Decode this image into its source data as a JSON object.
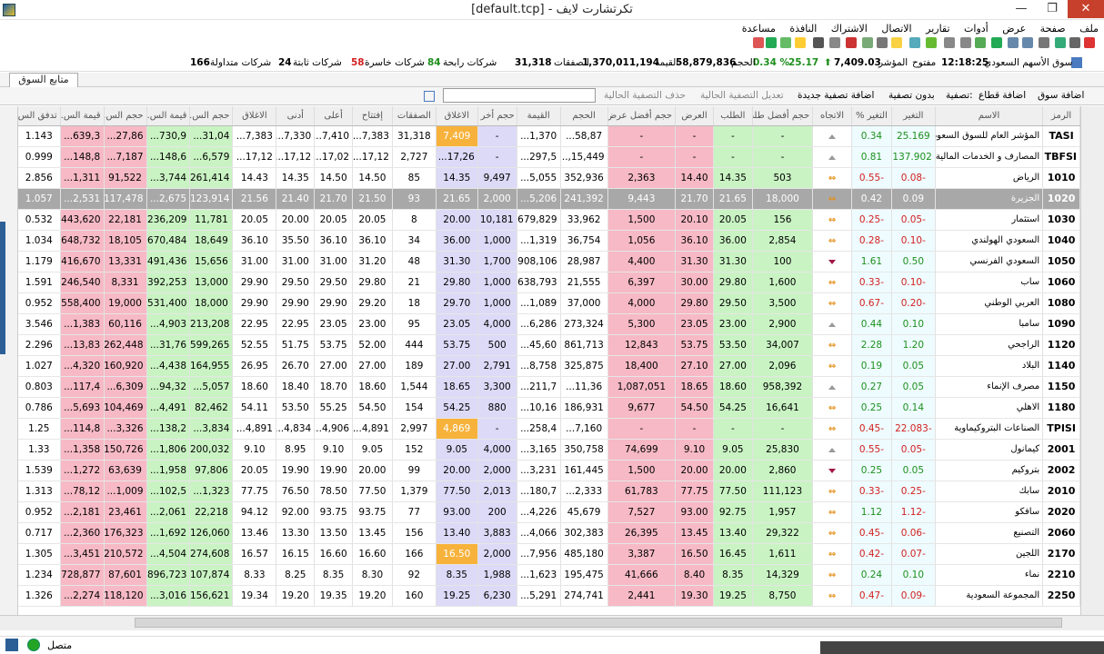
{
  "window": {
    "title": "[default.tcp] - تكرتشارت لايف",
    "min": "—",
    "max": "❐",
    "close": "✕"
  },
  "menu": [
    "ملف",
    "صفحة",
    "عرض",
    "أدوات",
    "تقارير",
    "الاتصال",
    "الاشتراك",
    "النافذة",
    "مساعدة"
  ],
  "marketstrip": {
    "market": "سوق الأسهم السعودي",
    "time": "12:18:25",
    "state": "مفتوح",
    "index_label": "المؤشر",
    "index": "7,409.03",
    "change": "25.17",
    "pct": "0.34 %",
    "vol_label": "الحجم",
    "volume": "58,879,836",
    "val_label": "القيمة",
    "value": "1,370,011,194",
    "trades_label": "الصفقات",
    "trades": "31,318",
    "up_label": "شركات رابحة",
    "up": "84",
    "down_label": "شركات خاسرة",
    "down": "58",
    "flat_label": "شركات ثابتة",
    "flat": "24",
    "traded_label": "شركات متداولة",
    "traded": "166"
  },
  "tab": {
    "label": "متابع السوق"
  },
  "filterbar": {
    "add_symbol": "اضافة سوق",
    "add_sector": "اضافة قطاع",
    "filter": "تصفية:",
    "no_filter": "بدون تصفية",
    "new_filter": "اضافة تصفية جديدة",
    "edit_filter": "تعديل التصفية الحالية",
    "delete_filter": "حذف التصفية الحالية"
  },
  "columns": [
    "الرمز",
    "الاسم",
    "التغير",
    "التغير %",
    "الاتجاه",
    "حجم أفضل طلب",
    "الطلب",
    "العرض",
    "حجم أفضل عرض",
    "الحجم",
    "القيمة",
    "حجم أخر",
    "الاغلاق",
    "الصفقات",
    "إفتتاح",
    "أعلى",
    "أدنى",
    "الاغلاق",
    "حجم الس...",
    "قيمة الس...",
    "حجم الس...",
    "قيمة الس...",
    "تدفق الس..."
  ],
  "rows": [
    {
      "sym": "TASI",
      "name": "المؤشر العام للسوق السعودي",
      "chg": "25.169",
      "pct": "0.34",
      "dir": "up",
      "bq": "-",
      "bid": "-",
      "ask": "-",
      "aq": "-",
      "vol": "58,87...",
      "val": "1,370...",
      "lastq": "-",
      "close": "7,409",
      "trades": "31,318",
      "open": "7,383...",
      "high": "7,410...",
      "low": "7,330...",
      "prev": "7,383...",
      "c1": "31,04...",
      "c2": "730,9...",
      "c3": "27,86...",
      "c4": "639,3...",
      "c5": "1.143"
    },
    {
      "sym": "TBFSI",
      "name": "المصارف و الخدمات المالية",
      "chg": "137.902",
      "pct": "0.81",
      "dir": "up",
      "bq": "-",
      "bid": "-",
      "ask": "-",
      "aq": "-",
      "vol": "15,449,...",
      "val": "297,5...",
      "lastq": "-",
      "close": "17,26...",
      "trades": "2,727",
      "open": "17,12...",
      "high": "17,02...",
      "low": "17,12...",
      "prev": "17,12...",
      "c1": "6,579...",
      "c2": "148,6...",
      "c3": "7,187...",
      "c4": "148,8...",
      "c5": "0.999"
    },
    {
      "sym": "1010",
      "name": "الرياض",
      "chg": "-0.08",
      "pct": "-0.55",
      "dir": "eq",
      "bq": "503",
      "bid": "14.35",
      "ask": "14.40",
      "aq": "2,363",
      "vol": "352,936",
      "val": "5,055...",
      "lastq": "9,497",
      "close": "14.35",
      "trades": "85",
      "open": "14.50",
      "high": "14.50",
      "low": "14.35",
      "prev": "14.43",
      "c1": "261,414",
      "c2": "3,744...",
      "c3": "91,522",
      "c4": "1,311...",
      "c5": "2.856"
    },
    {
      "sym": "1020",
      "name": "الجزيرة",
      "chg": "0.09",
      "pct": "0.42",
      "dir": "eq",
      "bq": "18,000",
      "bid": "21.65",
      "ask": "21.70",
      "aq": "9,443",
      "vol": "241,392",
      "val": "5,206...",
      "lastq": "2,000",
      "close": "21.65",
      "trades": "93",
      "open": "21.50",
      "high": "21.70",
      "low": "21.40",
      "prev": "21.56",
      "c1": "123,914",
      "c2": "2,675...",
      "c3": "117,478",
      "c4": "2,531...",
      "c5": "1.057",
      "sel": true
    },
    {
      "sym": "1030",
      "name": "استثمار",
      "chg": "-0.05",
      "pct": "-0.25",
      "dir": "eq",
      "bq": "156",
      "bid": "20.05",
      "ask": "20.10",
      "aq": "1,500",
      "vol": "33,962",
      "val": "679,829",
      "lastq": "10,181",
      "close": "20.00",
      "trades": "8",
      "open": "20.05",
      "high": "20.05",
      "low": "20.00",
      "prev": "20.05",
      "c1": "11,781",
      "c2": "236,209",
      "c3": "22,181",
      "c4": "443,620",
      "c5": "0.532"
    },
    {
      "sym": "1040",
      "name": "السعودي الهولندي",
      "chg": "-0.10",
      "pct": "-0.28",
      "dir": "eq",
      "bq": "2,854",
      "bid": "36.00",
      "ask": "36.10",
      "aq": "1,056",
      "vol": "36,754",
      "val": "1,319...",
      "lastq": "1,000",
      "close": "36.00",
      "trades": "34",
      "open": "36.10",
      "high": "36.10",
      "low": "35.50",
      "prev": "36.10",
      "c1": "18,649",
      "c2": "670,484",
      "c3": "18,105",
      "c4": "648,732",
      "c5": "1.034"
    },
    {
      "sym": "1050",
      "name": "السعودي الفرنسي",
      "chg": "0.50",
      "pct": "1.61",
      "dir": "dn",
      "bq": "100",
      "bid": "31.30",
      "ask": "31.30",
      "aq": "4,400",
      "vol": "28,987",
      "val": "908,106",
      "lastq": "1,700",
      "close": "31.30",
      "trades": "48",
      "open": "31.20",
      "high": "31.00",
      "low": "31.00",
      "prev": "31.00",
      "c1": "15,656",
      "c2": "491,436",
      "c3": "13,331",
      "c4": "416,670",
      "c5": "1.179"
    },
    {
      "sym": "1060",
      "name": "ساب",
      "chg": "-0.10",
      "pct": "-0.33",
      "dir": "eq",
      "bq": "1,600",
      "bid": "29.80",
      "ask": "30.00",
      "aq": "6,397",
      "vol": "21,555",
      "val": "638,793",
      "lastq": "1,000",
      "close": "29.80",
      "trades": "21",
      "open": "29.80",
      "high": "29.50",
      "low": "29.50",
      "prev": "29.90",
      "c1": "13,000",
      "c2": "392,253",
      "c3": "8,331",
      "c4": "246,540",
      "c5": "1.591"
    },
    {
      "sym": "1080",
      "name": "العربي الوطني",
      "chg": "-0.20",
      "pct": "-0.67",
      "dir": "eq",
      "bq": "3,500",
      "bid": "29.50",
      "ask": "29.80",
      "aq": "4,000",
      "vol": "37,000",
      "val": "1,089...",
      "lastq": "1,000",
      "close": "29.70",
      "trades": "18",
      "open": "29.20",
      "high": "29.90",
      "low": "29.90",
      "prev": "29.90",
      "c1": "18,000",
      "c2": "531,400",
      "c3": "19,000",
      "c4": "558,400",
      "c5": "0.952"
    },
    {
      "sym": "1090",
      "name": "سامبا",
      "chg": "0.10",
      "pct": "0.44",
      "dir": "up",
      "bq": "2,900",
      "bid": "23.00",
      "ask": "23.05",
      "aq": "5,300",
      "vol": "273,324",
      "val": "6,286...",
      "lastq": "4,000",
      "close": "23.05",
      "trades": "95",
      "open": "23.00",
      "high": "23.05",
      "low": "22.95",
      "prev": "22.95",
      "c1": "213,208",
      "c2": "4,903...",
      "c3": "60,116",
      "c4": "1,383...",
      "c5": "3.546"
    },
    {
      "sym": "1120",
      "name": "الراجحي",
      "chg": "1.20",
      "pct": "2.28",
      "dir": "eq",
      "bq": "34,007",
      "bid": "53.50",
      "ask": "53.75",
      "aq": "12,843",
      "vol": "861,713",
      "val": "45,60...",
      "lastq": "500",
      "close": "53.75",
      "trades": "444",
      "open": "52.00",
      "high": "53.75",
      "low": "51.75",
      "prev": "52.55",
      "c1": "599,265",
      "c2": "31,76...",
      "c3": "262,448",
      "c4": "13,83...",
      "c5": "2.296"
    },
    {
      "sym": "1140",
      "name": "البلاد",
      "chg": "0.05",
      "pct": "0.19",
      "dir": "eq",
      "bq": "2,096",
      "bid": "27.00",
      "ask": "27.10",
      "aq": "18,400",
      "vol": "325,875",
      "val": "8,758...",
      "lastq": "2,791",
      "close": "27.00",
      "trades": "189",
      "open": "27.00",
      "high": "27.00",
      "low": "26.70",
      "prev": "26.95",
      "c1": "164,955",
      "c2": "4,438...",
      "c3": "160,920",
      "c4": "4,320...",
      "c5": "1.027"
    },
    {
      "sym": "1150",
      "name": "مصرف الإنماء",
      "chg": "0.05",
      "pct": "0.27",
      "dir": "up",
      "bq": "958,392",
      "bid": "18.60",
      "ask": "18.65",
      "aq": "1,087,051",
      "vol": "11,36...",
      "val": "211,7...",
      "lastq": "3,300",
      "close": "18.65",
      "trades": "1,544",
      "open": "18.60",
      "high": "18.70",
      "low": "18.40",
      "prev": "18.60",
      "c1": "5,057...",
      "c2": "94,32...",
      "c3": "6,309...",
      "c4": "117,4...",
      "c5": "0.803"
    },
    {
      "sym": "1180",
      "name": "الاهلي",
      "chg": "0.14",
      "pct": "0.25",
      "dir": "eq",
      "bq": "16,641",
      "bid": "54.25",
      "ask": "54.50",
      "aq": "9,677",
      "vol": "186,931",
      "val": "10,16...",
      "lastq": "880",
      "close": "54.25",
      "trades": "154",
      "open": "54.50",
      "high": "55.25",
      "low": "53.50",
      "prev": "54.11",
      "c1": "82,462",
      "c2": "4,491...",
      "c3": "104,469",
      "c4": "5,693...",
      "c5": "0.786"
    },
    {
      "sym": "TPISI",
      "name": "الصناعات البتروكيماوية",
      "chg": "-22.083",
      "pct": "-0.45",
      "dir": "eq",
      "bq": "-",
      "bid": "-",
      "ask": "-",
      "aq": "-",
      "vol": "7,160...",
      "val": "258,4...",
      "lastq": "-",
      "close": "4,869",
      "trades": "2,997",
      "open": "4,891...",
      "high": "4,906...",
      "low": "4,834...",
      "prev": "4,891...",
      "c1": "3,834...",
      "c2": "138,2...",
      "c3": "3,326...",
      "c4": "114,8...",
      "c5": "1.25"
    },
    {
      "sym": "2001",
      "name": "كيمانول",
      "chg": "-0.05",
      "pct": "-0.55",
      "dir": "up",
      "bq": "25,830",
      "bid": "9.05",
      "ask": "9.10",
      "aq": "74,699",
      "vol": "350,758",
      "val": "3,165...",
      "lastq": "4,000",
      "close": "9.05",
      "trades": "152",
      "open": "9.05",
      "high": "9.10",
      "low": "8.95",
      "prev": "9.10",
      "c1": "200,032",
      "c2": "1,806...",
      "c3": "150,726",
      "c4": "1,358...",
      "c5": "1.33"
    },
    {
      "sym": "2002",
      "name": "بتروكيم",
      "chg": "0.05",
      "pct": "0.25",
      "dir": "dn",
      "bq": "2,860",
      "bid": "20.00",
      "ask": "20.00",
      "aq": "1,500",
      "vol": "161,445",
      "val": "3,231...",
      "lastq": "2,000",
      "close": "20.00",
      "trades": "99",
      "open": "20.00",
      "high": "19.90",
      "low": "19.90",
      "prev": "20.05",
      "c1": "97,806",
      "c2": "1,958...",
      "c3": "63,639",
      "c4": "1,272...",
      "c5": "1.539"
    },
    {
      "sym": "2010",
      "name": "سابك",
      "chg": "-0.25",
      "pct": "-0.33",
      "dir": "eq",
      "bq": "111,123",
      "bid": "77.50",
      "ask": "77.75",
      "aq": "61,783",
      "vol": "2,333...",
      "val": "180,7...",
      "lastq": "2,013",
      "close": "77.50",
      "trades": "1,379",
      "open": "77.50",
      "high": "78.50",
      "low": "76.50",
      "prev": "77.75",
      "c1": "1,323...",
      "c2": "102,5...",
      "c3": "1,009...",
      "c4": "78,12...",
      "c5": "1.313"
    },
    {
      "sym": "2020",
      "name": "سافكو",
      "chg": "-1.12",
      "pct": "1.12",
      "dir": "eq",
      "bq": "1,957",
      "bid": "92.75",
      "ask": "93.00",
      "aq": "7,527",
      "vol": "45,679",
      "val": "4,226...",
      "lastq": "200",
      "close": "93.00",
      "trades": "77",
      "open": "93.75",
      "high": "93.75",
      "low": "92.00",
      "prev": "94.12",
      "c1": "22,218",
      "c2": "2,061...",
      "c3": "23,461",
      "c4": "2,181...",
      "c5": "0.952"
    },
    {
      "sym": "2060",
      "name": "التصنيع",
      "chg": "-0.06",
      "pct": "-0.45",
      "dir": "eq",
      "bq": "29,322",
      "bid": "13.40",
      "ask": "13.45",
      "aq": "26,395",
      "vol": "302,383",
      "val": "4,066...",
      "lastq": "3,883",
      "close": "13.40",
      "trades": "156",
      "open": "13.45",
      "high": "13.50",
      "low": "13.30",
      "prev": "13.46",
      "c1": "126,060",
      "c2": "1,692...",
      "c3": "176,323",
      "c4": "2,360...",
      "c5": "0.717"
    },
    {
      "sym": "2170",
      "name": "اللجين",
      "chg": "-0.07",
      "pct": "-0.42",
      "dir": "eq",
      "bq": "1,611",
      "bid": "16.45",
      "ask": "16.50",
      "aq": "3,387",
      "vol": "485,180",
      "val": "7,956...",
      "lastq": "2,000",
      "close": "16.50",
      "trades": "166",
      "open": "16.60",
      "high": "16.60",
      "low": "16.15",
      "prev": "16.57",
      "c1": "274,608",
      "c2": "4,504...",
      "c3": "210,572",
      "c4": "3,451...",
      "c5": "1.305"
    },
    {
      "sym": "2210",
      "name": "نماء",
      "chg": "0.10",
      "pct": "0.24",
      "dir": "eq",
      "bq": "14,329",
      "bid": "8.35",
      "ask": "8.40",
      "aq": "41,666",
      "vol": "195,475",
      "val": "1,623...",
      "lastq": "1,988",
      "close": "8.35",
      "trades": "92",
      "open": "8.30",
      "high": "8.35",
      "low": "8.25",
      "prev": "8.33",
      "c1": "107,874",
      "c2": "896,723",
      "c3": "87,601",
      "c4": "728,877",
      "c5": "1.234"
    },
    {
      "sym": "2250",
      "name": "المجموعة السعودية",
      "chg": "-0.09",
      "pct": "-0.47",
      "dir": "eq",
      "bq": "8,750",
      "bid": "19.25",
      "ask": "19.30",
      "aq": "2,441",
      "vol": "274,741",
      "val": "5,291...",
      "lastq": "6,230",
      "close": "19.25",
      "trades": "160",
      "open": "19.20",
      "high": "19.35",
      "low": "19.20",
      "prev": "19.34",
      "c1": "156,621",
      "c2": "3,016...",
      "c3": "118,120",
      "c4": "2,274...",
      "c5": "1.326"
    }
  ],
  "status": {
    "text": "متصل"
  },
  "colors": {
    "green": "#c9f3c3",
    "red": "#f6b9c5",
    "purple": "#dcdaf7",
    "orange": "#f7b23c",
    "selected": "#a8a8a8"
  }
}
